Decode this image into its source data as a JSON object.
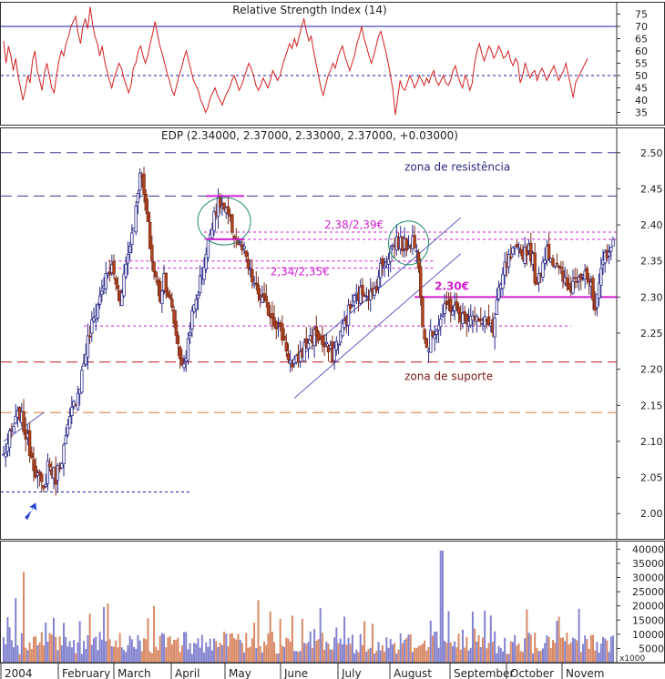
{
  "chart_data": [
    {
      "type": "line",
      "panel": "rsi",
      "title": "Relative Strength Index (14)",
      "ylim": [
        30,
        80
      ],
      "y_ticks": [
        35,
        40,
        45,
        50,
        55,
        60,
        65,
        70,
        75
      ],
      "reference_lines": [
        {
          "value": 70,
          "style": "solid",
          "color": "#1a1aa8"
        },
        {
          "value": 50,
          "style": "dotted",
          "color": "#1a1aa8"
        }
      ],
      "series": [
        {
          "color": "#d42020",
          "values": [
            64,
            55,
            62,
            58,
            52,
            57,
            50,
            45,
            40,
            44,
            50,
            47,
            56,
            60,
            52,
            48,
            44,
            51,
            55,
            50,
            45,
            43,
            50,
            56,
            60,
            58,
            63,
            66,
            70,
            72,
            74,
            67,
            63,
            70,
            73,
            69,
            78,
            71,
            66,
            63,
            58,
            62,
            56,
            52,
            48,
            45,
            49,
            52,
            55,
            53,
            49,
            46,
            43,
            46,
            53,
            55,
            60,
            62,
            58,
            55,
            58,
            63,
            67,
            72,
            67,
            62,
            59,
            55,
            51,
            48,
            44,
            42,
            46,
            50,
            53,
            57,
            60,
            56,
            52,
            48,
            46,
            44,
            40,
            38,
            35,
            37,
            41,
            43,
            45,
            42,
            40,
            38,
            41,
            43,
            45,
            48,
            50,
            47,
            44,
            46,
            49,
            52,
            55,
            53,
            50,
            46,
            44,
            46,
            49,
            47,
            45,
            48,
            52,
            50,
            48,
            50,
            54,
            57,
            60,
            63,
            61,
            65,
            62,
            66,
            70,
            73,
            68,
            64,
            66,
            60,
            55,
            50,
            45,
            42,
            46,
            50,
            52,
            55,
            53,
            57,
            60,
            62,
            58,
            55,
            52,
            55,
            58,
            63,
            66,
            70,
            65,
            62,
            58,
            55,
            58,
            62,
            66,
            68,
            64,
            60,
            55,
            50,
            44,
            34,
            41,
            48,
            45,
            44,
            47,
            50,
            48,
            45,
            47,
            50,
            48,
            46,
            49,
            47,
            50,
            52,
            48,
            46,
            48,
            50,
            47,
            46,
            48,
            52,
            54,
            50,
            47,
            45,
            50,
            48,
            44,
            47,
            55,
            60,
            63,
            59,
            56,
            59,
            62,
            60,
            57,
            59,
            62,
            60,
            57,
            58,
            60,
            56,
            54,
            57,
            55,
            47,
            50,
            55,
            52,
            49,
            51,
            52,
            48,
            51,
            53,
            51,
            48,
            50,
            52,
            54,
            51,
            48,
            50,
            52,
            55,
            50,
            46,
            41,
            47,
            49,
            51,
            53,
            55,
            57
          ]
        }
      ],
      "x_months": []
    },
    {
      "type": "candlestick",
      "panel": "price",
      "title": "EDP (2.34000, 2.37000, 2.33000, 2.37000, +0.03000)",
      "ylim": [
        1.965,
        2.535
      ],
      "y_ticks": [
        2.0,
        2.05,
        2.1,
        2.15,
        2.2,
        2.25,
        2.3,
        2.35,
        2.4,
        2.45,
        2.5
      ],
      "close_anchors": [
        [
          0,
          2.08
        ],
        [
          5,
          2.12
        ],
        [
          8,
          2.14
        ],
        [
          12,
          2.1
        ],
        [
          16,
          2.06
        ],
        [
          20,
          2.03
        ],
        [
          22,
          2.07
        ],
        [
          26,
          2.05
        ],
        [
          30,
          2.09
        ],
        [
          34,
          2.14
        ],
        [
          38,
          2.18
        ],
        [
          42,
          2.24
        ],
        [
          46,
          2.28
        ],
        [
          50,
          2.32
        ],
        [
          54,
          2.34
        ],
        [
          58,
          2.3
        ],
        [
          62,
          2.36
        ],
        [
          66,
          2.42
        ],
        [
          68,
          2.48
        ],
        [
          70,
          2.44
        ],
        [
          74,
          2.35
        ],
        [
          78,
          2.3
        ],
        [
          80,
          2.33
        ],
        [
          84,
          2.28
        ],
        [
          88,
          2.22
        ],
        [
          90,
          2.2
        ],
        [
          93,
          2.26
        ],
        [
          97,
          2.31
        ],
        [
          101,
          2.36
        ],
        [
          105,
          2.42
        ],
        [
          108,
          2.43
        ],
        [
          112,
          2.41
        ],
        [
          116,
          2.38
        ],
        [
          120,
          2.36
        ],
        [
          123,
          2.33
        ],
        [
          126,
          2.31
        ],
        [
          130,
          2.29
        ],
        [
          135,
          2.27
        ],
        [
          140,
          2.24
        ],
        [
          144,
          2.2
        ],
        [
          148,
          2.22
        ],
        [
          152,
          2.24
        ],
        [
          156,
          2.25
        ],
        [
          160,
          2.23
        ],
        [
          164,
          2.22
        ],
        [
          168,
          2.25
        ],
        [
          172,
          2.28
        ],
        [
          176,
          2.3
        ],
        [
          180,
          2.31
        ],
        [
          184,
          2.3
        ],
        [
          188,
          2.34
        ],
        [
          192,
          2.36
        ],
        [
          196,
          2.38
        ],
        [
          200,
          2.37
        ],
        [
          204,
          2.38
        ],
        [
          207,
          2.35
        ],
        [
          209,
          2.27
        ],
        [
          211,
          2.23
        ],
        [
          214,
          2.25
        ],
        [
          218,
          2.27
        ],
        [
          222,
          2.29
        ],
        [
          226,
          2.28
        ],
        [
          230,
          2.27
        ],
        [
          234,
          2.28
        ],
        [
          238,
          2.26
        ],
        [
          242,
          2.27
        ],
        [
          244,
          2.25
        ],
        [
          246,
          2.29
        ],
        [
          250,
          2.34
        ],
        [
          254,
          2.36
        ],
        [
          258,
          2.36
        ],
        [
          262,
          2.37
        ],
        [
          264,
          2.35
        ],
        [
          266,
          2.31
        ],
        [
          268,
          2.34
        ],
        [
          271,
          2.37
        ],
        [
          274,
          2.35
        ],
        [
          278,
          2.33
        ],
        [
          282,
          2.31
        ],
        [
          286,
          2.33
        ],
        [
          290,
          2.34
        ],
        [
          293,
          2.31
        ],
        [
          295,
          2.28
        ],
        [
          297,
          2.31
        ],
        [
          299,
          2.35
        ],
        [
          302,
          2.37
        ]
      ],
      "x_range": [
        0,
        305
      ],
      "reference_lines": [
        {
          "value": 2.5,
          "style": "long-dash",
          "color": "#3a3a8a"
        },
        {
          "value": 2.44,
          "style": "long-dash",
          "color": "#3a3a8a"
        },
        {
          "value": 2.39,
          "style": "dotted",
          "color": "#d01fd0"
        },
        {
          "value": 2.38,
          "style": "dotted",
          "color": "#d01fd0"
        },
        {
          "value": 2.35,
          "style": "dotted",
          "color": "#d01fd0"
        },
        {
          "value": 2.34,
          "style": "dotted",
          "color": "#d01fd0"
        },
        {
          "value": 2.26,
          "style": "dotted",
          "color": "#d01fd0"
        },
        {
          "value": 2.21,
          "style": "long-dash",
          "color": "#c01818"
        },
        {
          "value": 2.14,
          "style": "long-dash",
          "color": "#e07a3a"
        },
        {
          "value": 2.03,
          "style": "dotted",
          "color": "#1a1aa8"
        },
        {
          "value": 2.3,
          "style": "solid",
          "color": "#d01fd0"
        }
      ],
      "annotations": [
        {
          "text": "zona de resistência",
          "x": 200,
          "y": 2.475,
          "color": "#2a2a7a"
        },
        {
          "text": "zona de suporte",
          "x": 200,
          "y": 2.185,
          "color": "#7a1a1a"
        },
        {
          "text": "2,38/2,39€",
          "x": 160,
          "y": 2.395,
          "color": "#d01fd0"
        },
        {
          "text": "2,34/2,35€",
          "x": 133,
          "y": 2.33,
          "color": "#d01fd0"
        },
        {
          "text": "2.30€",
          "x": 215,
          "y": 2.31,
          "color": "#d01fd0"
        }
      ]
    },
    {
      "type": "bar",
      "panel": "volume",
      "ylim": [
        0,
        43000
      ],
      "y_ticks": [
        5000,
        10000,
        15000,
        20000,
        25000,
        30000,
        35000,
        40000
      ],
      "y_unit": "x1000",
      "x_months": [
        "2004",
        "February",
        "March",
        "April",
        "May",
        "June",
        "July",
        "August",
        "September",
        "October",
        "Novem"
      ],
      "colors": {
        "up": "#8383d0",
        "down": "#d98a66"
      }
    }
  ]
}
